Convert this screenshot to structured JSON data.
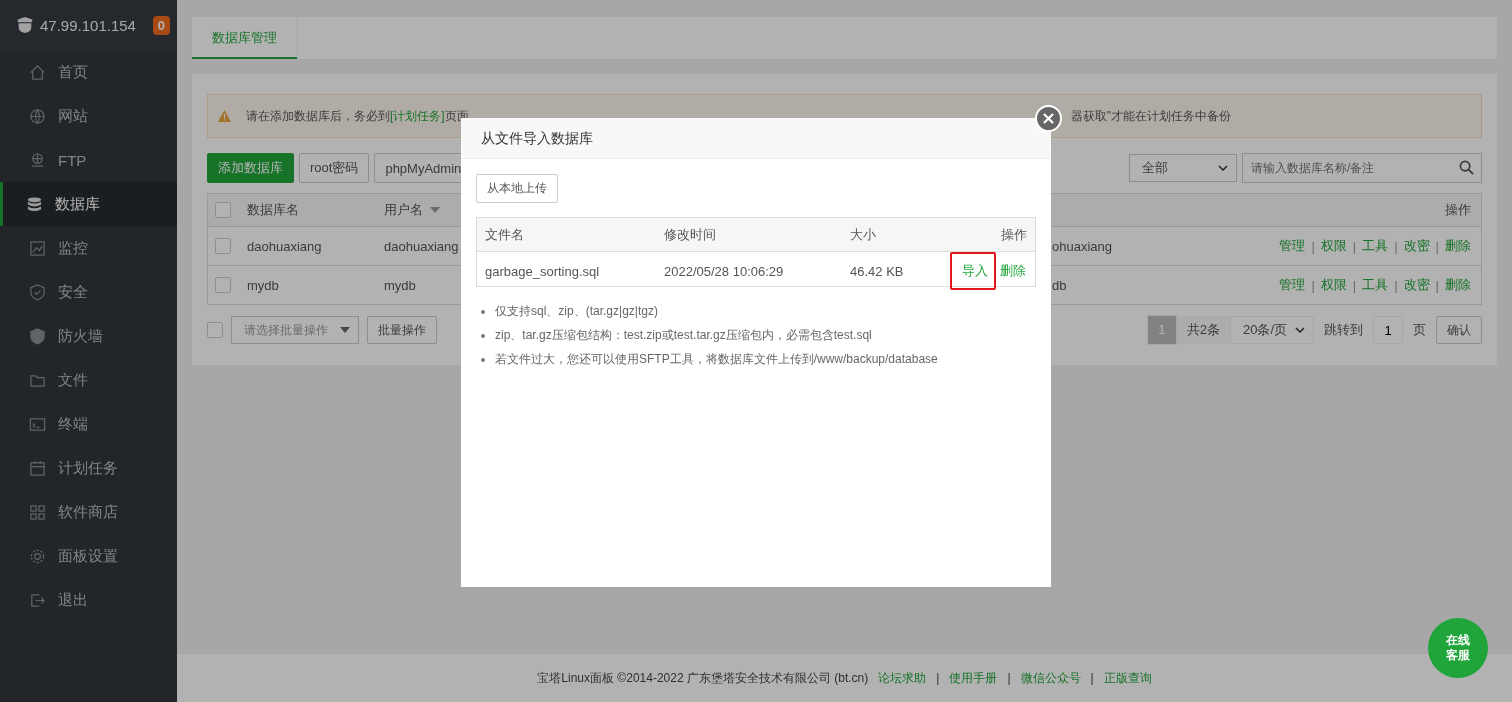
{
  "sidebar": {
    "host": "47.99.101.154",
    "badge": "0",
    "items": [
      {
        "label": "首页",
        "kind": "home",
        "selected": false
      },
      {
        "label": "网站",
        "kind": "globe",
        "selected": false
      },
      {
        "label": "FTP",
        "kind": "ftp",
        "selected": false
      },
      {
        "label": "数据库",
        "kind": "database",
        "selected": true
      },
      {
        "label": "监控",
        "kind": "monitor",
        "selected": false
      },
      {
        "label": "安全",
        "kind": "shield",
        "selected": false
      },
      {
        "label": "防火墙",
        "kind": "firewall",
        "selected": false
      },
      {
        "label": "文件",
        "kind": "folder",
        "selected": false
      },
      {
        "label": "终端",
        "kind": "terminal",
        "selected": false
      },
      {
        "label": "计划任务",
        "kind": "calendar",
        "selected": false
      },
      {
        "label": "软件商店",
        "kind": "grid",
        "selected": false
      },
      {
        "label": "面板设置",
        "kind": "gear",
        "selected": false
      },
      {
        "label": "退出",
        "kind": "logout",
        "selected": false
      }
    ]
  },
  "tabs": [
    {
      "label": "数据库管理",
      "selected": true
    }
  ],
  "warning": {
    "before": "请在添加数据库后，务必到",
    "link": "[计划任务]",
    "after": "页面",
    "tail": "器获取\"才能在计划任务中备份"
  },
  "toolbar": {
    "buttons": [
      {
        "label": "添加数据库",
        "kind": "primary"
      },
      {
        "label": "root密码",
        "kind": "default"
      },
      {
        "label": "phpMyAdmin",
        "kind": "default"
      }
    ],
    "filter": "全部",
    "search_placeholder": "请输入数据库名称/备注"
  },
  "table": {
    "header_checked": false,
    "columns": [
      "数据库名",
      "用户名",
      "",
      "操作"
    ],
    "separator": "|",
    "rows": [
      {
        "checked": false,
        "name": "daohuaxiang",
        "user": "daohuaxiang",
        "column_3": "ohuaxiang",
        "actions": [
          "管理",
          "权限",
          "工具",
          "改密",
          "删除"
        ]
      },
      {
        "checked": false,
        "name": "mydb",
        "user": "mydb",
        "column_3": "db",
        "actions": [
          "管理",
          "权限",
          "工具",
          "改密",
          "删除"
        ]
      }
    ]
  },
  "batch": {
    "checked": false,
    "select_placeholder": "请选择批量操作",
    "button": "批量操作"
  },
  "pagination": {
    "pages": [
      {
        "label": "1",
        "selected": true
      }
    ],
    "total": "共2条",
    "per_page": "20条/页",
    "goto": "跳转到",
    "page_input": "1",
    "page_unit": "页",
    "confirm": "确认"
  },
  "modal": {
    "title": "从文件导入数据库",
    "upload_button": "从本地上传",
    "columns": [
      "文件名",
      "修改时间",
      "大小",
      "操作"
    ],
    "files": [
      {
        "name": "garbage_sorting.sql",
        "modified": "2022/05/28 10:06:29",
        "size": "46.42 KB",
        "actions": [
          {
            "label": "导入",
            "highlighted": true
          },
          {
            "label": "删除",
            "highlighted": false
          }
        ]
      }
    ],
    "notes": [
      "仅支持sql、zip、(tar.gz|gz|tgz)",
      "zip、tar.gz压缩包结构：test.zip或test.tar.gz压缩包内，必需包含test.sql",
      "若文件过大，您还可以使用SFTP工具，将数据库文件上传到/www/backup/database"
    ]
  },
  "footer": {
    "copyright": "宝塔Linux面板 ©2014-2022 广东堡塔安全技术有限公司 (bt.cn)",
    "separator": "|",
    "links": [
      "论坛求助",
      "使用手册",
      "微信公众号",
      "正版查询"
    ]
  },
  "chat_button": "在线客服"
}
